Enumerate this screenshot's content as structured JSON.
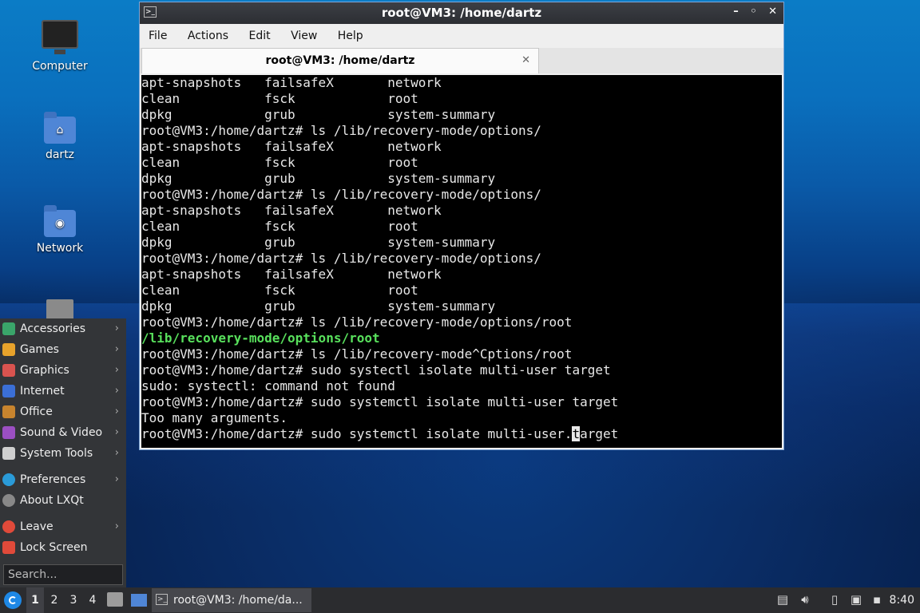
{
  "desktop": {
    "icons": [
      {
        "label": "Computer"
      },
      {
        "label": "dartz"
      },
      {
        "label": "Network"
      },
      {
        "label": ""
      }
    ]
  },
  "window": {
    "title": "root@VM3: /home/dartz",
    "controls": {
      "minimize": "–",
      "maximize": "◦",
      "close": "✕"
    },
    "menu": [
      "File",
      "Actions",
      "Edit",
      "View",
      "Help"
    ],
    "tab": {
      "label": "root@VM3: /home/dartz",
      "close": "✕"
    }
  },
  "terminal": {
    "lines": [
      "apt-snapshots   failsafeX       network",
      "clean           fsck            root",
      "dpkg            grub            system-summary",
      "root@VM3:/home/dartz# ls /lib/recovery-mode/options/",
      "apt-snapshots   failsafeX       network",
      "clean           fsck            root",
      "dpkg            grub            system-summary",
      "root@VM3:/home/dartz# ls /lib/recovery-mode/options/",
      "apt-snapshots   failsafeX       network",
      "clean           fsck            root",
      "dpkg            grub            system-summary",
      "root@VM3:/home/dartz# ls /lib/recovery-mode/options/",
      "apt-snapshots   failsafeX       network",
      "clean           fsck            root",
      "dpkg            grub            system-summary",
      "root@VM3:/home/dartz# ls /lib/recovery-mode/options/root",
      "/lib/recovery-mode/options/root",
      "root@VM3:/home/dartz# ls /lib/recovery-mode^Cptions/root",
      "root@VM3:/home/dartz# sudo systectl isolate multi-user target",
      "sudo: systectl: command not found",
      "root@VM3:/home/dartz# sudo systemctl isolate multi-user target",
      "Too many arguments."
    ],
    "last_line_before_cursor": "root@VM3:/home/dartz# sudo systemctl isolate multi-user.",
    "cursor_char": "t",
    "last_line_after_cursor": "arget",
    "green_color": "#58e05c"
  },
  "start_menu": {
    "categories": [
      {
        "label": "Accessories",
        "icon": "accessories-icon",
        "color": "#3aa56a"
      },
      {
        "label": "Games",
        "icon": "games-icon",
        "color": "#e8a32b"
      },
      {
        "label": "Graphics",
        "icon": "graphics-icon",
        "color": "#d9534f"
      },
      {
        "label": "Internet",
        "icon": "internet-icon",
        "color": "#3b6fd6"
      },
      {
        "label": "Office",
        "icon": "office-icon",
        "color": "#c7842e"
      },
      {
        "label": "Sound & Video",
        "icon": "sound-video-icon",
        "color": "#9b4fc2"
      },
      {
        "label": "System Tools",
        "icon": "system-tools-icon",
        "color": "#cfcfcf"
      }
    ],
    "preferences": {
      "label": "Preferences"
    },
    "about": {
      "label": "About LXQt"
    },
    "leave": {
      "label": "Leave"
    },
    "lock": {
      "label": "Lock Screen"
    },
    "search_placeholder": "Search..."
  },
  "taskbar": {
    "desktops": [
      "1",
      "2",
      "3",
      "4"
    ],
    "task_label": "root@VM3: /home/da...",
    "clock": "8:40"
  }
}
